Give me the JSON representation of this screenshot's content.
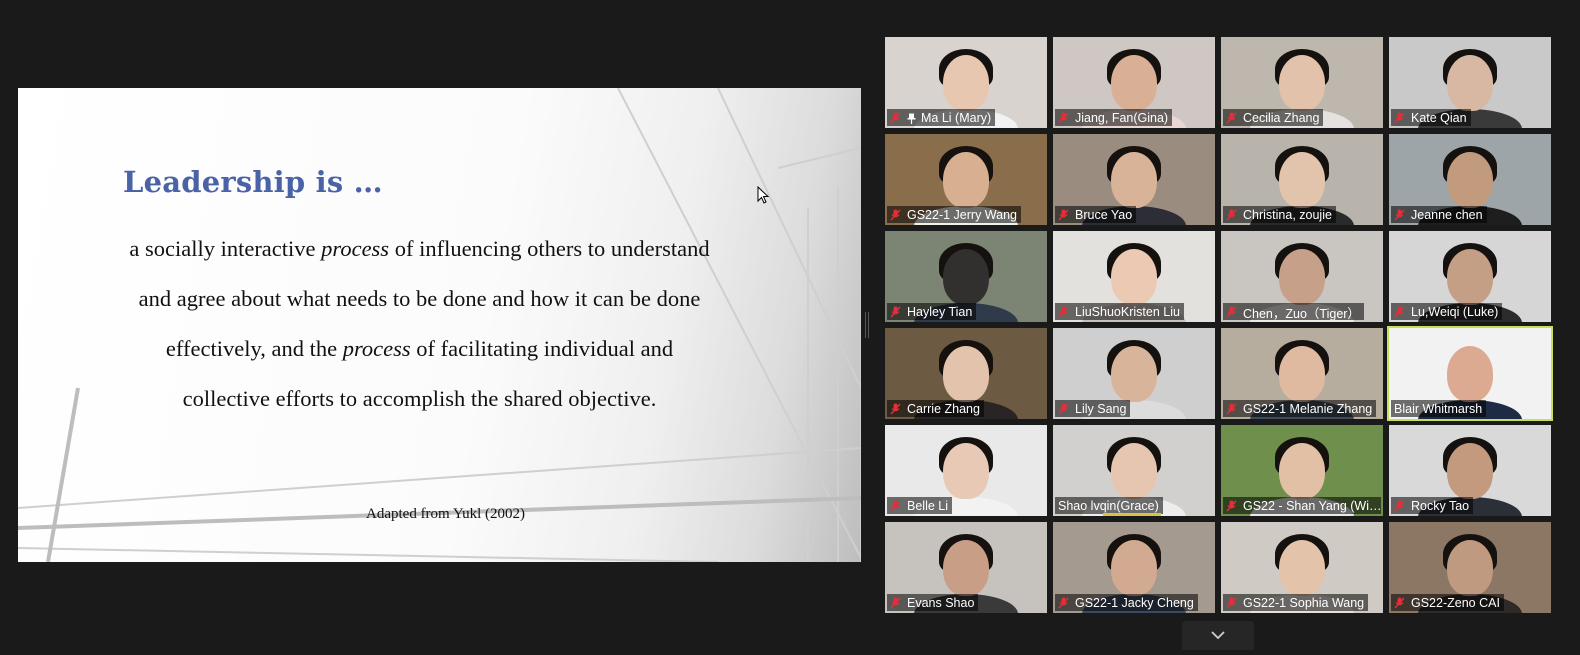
{
  "slide": {
    "title": "Leadership is …",
    "body_lines": [
      {
        "pre": "a socially interactive ",
        "em": "process",
        "post": " of influencing others to understand"
      },
      {
        "pre": "and agree about what needs to be done and how it can be done",
        "em": "",
        "post": ""
      },
      {
        "pre": "effectively, and the ",
        "em": "process",
        "post": " of facilitating individual and"
      },
      {
        "pre": "collective efforts to accomplish the shared objective.",
        "em": "",
        "post": ""
      }
    ],
    "source": "Adapted from Yukl (2002)"
  },
  "participants": [
    {
      "name": "Ma Li (Mary)",
      "muted": true,
      "pinned": true,
      "bg": "#d8d3cf",
      "skin": "#e7c7b0",
      "hair": true,
      "shirt": "#f2f2f2"
    },
    {
      "name": "Jiang, Fan(Gina)",
      "muted": true,
      "bg": "#cfc7c4",
      "skin": "#d9b095",
      "hair": true,
      "shirt": "#e8d7d2"
    },
    {
      "name": "Cecilia Zhang",
      "muted": true,
      "bg": "#bdb7ae",
      "skin": "#e2c2aa",
      "hair": true,
      "shirt": "#e4e1de"
    },
    {
      "name": "Kate Qian",
      "muted": true,
      "bg": "#c9c9c9",
      "skin": "#d9b8a3",
      "hair": true,
      "shirt": "#3a3a3a"
    },
    {
      "name": "GS22-1 Jerry Wang",
      "muted": true,
      "bg": "#8a6e4c",
      "skin": "#d8b091",
      "hair": true,
      "shirt": "#f0efea"
    },
    {
      "name": "Bruce Yao",
      "muted": true,
      "bg": "#9a8c7f",
      "skin": "#d9b398",
      "hair": true,
      "shirt": "#2c2d35"
    },
    {
      "name": "Christina, zoujie",
      "muted": true,
      "bg": "#b8b4ab",
      "skin": "#e2c4ad",
      "hair": true,
      "shirt": "#2a2a2a"
    },
    {
      "name": "Jeanne chen",
      "muted": true,
      "bg": "#9ea5a8",
      "skin": "#c29a7e",
      "hair": true,
      "shirt": "#1e1e1e"
    },
    {
      "name": "Hayley Tian",
      "muted": true,
      "bg": "#7c8473",
      "skin": "#31302e",
      "hair": true,
      "shirt": "#2f3a4a"
    },
    {
      "name": "LiuShuoKristen Liu",
      "muted": true,
      "bg": "#e3e1de",
      "skin": "#ecc9b3",
      "hair": true,
      "shirt": "#c9c2bc"
    },
    {
      "name": "Chen，Zuo（Tiger）",
      "muted": true,
      "bg": "#c9c6c2",
      "skin": "#c7a089",
      "hair": true,
      "shirt": "#ece9e6"
    },
    {
      "name": "Lu,Weiqi (Luke)",
      "muted": true,
      "bg": "#d6d6d6",
      "skin": "#c59e86",
      "hair": true,
      "shirt": "#2e2b2b"
    },
    {
      "name": "Carrie Zhang",
      "muted": true,
      "bg": "#6d5a43",
      "skin": "#e3c3ab",
      "hair": true,
      "shirt": "#2a2525"
    },
    {
      "name": "Lily  Sang",
      "muted": true,
      "bg": "#cfcfcf",
      "skin": "#d8b49b",
      "hair": true,
      "shirt": "#dcdcdc"
    },
    {
      "name": "GS22-1 Melanie Zhang",
      "muted": true,
      "bg": "#b6ad9e",
      "skin": "#dfbaa0",
      "hair": true,
      "shirt": "#3f4c5a"
    },
    {
      "name": "Blair Whitmarsh",
      "muted": false,
      "active": true,
      "bg": "#f2f2f2",
      "skin": "#dcaa90",
      "hair": false,
      "shirt": "#1f2a44"
    },
    {
      "name": "Belle Li",
      "muted": true,
      "bg": "#e9e9e9",
      "skin": "#e8c9b6",
      "hair": true,
      "shirt": "#f2f2f2"
    },
    {
      "name": "Shao lvqin(Grace)",
      "muted": false,
      "speaking": true,
      "bg": "#d2d0ce",
      "skin": "#e6c6b0",
      "hair": true,
      "shirt": "#ededed"
    },
    {
      "name": "GS22 - Shan Yang (Wi…",
      "muted": true,
      "bg": "#6f8f4d",
      "skin": "#e1c0a6",
      "hair": true,
      "shirt": "#e9e9e9"
    },
    {
      "name": "Rocky Tao",
      "muted": true,
      "bg": "#d9d9d9",
      "skin": "#c39a7e",
      "hair": true,
      "shirt": "#2b2f38"
    },
    {
      "name": "Evans Shao",
      "muted": true,
      "bg": "#c6c3bf",
      "skin": "#c89e86",
      "hair": true,
      "shirt": "#3a3a3a"
    },
    {
      "name": "GS22-1 Jacky Cheng",
      "muted": true,
      "bg": "#a59a90",
      "skin": "#d2aa92",
      "hair": true,
      "shirt": "#3d4a5d"
    },
    {
      "name": "GS22-1 Sophia Wang",
      "muted": true,
      "bg": "#cfcac4",
      "skin": "#e4c3ab",
      "hair": true,
      "shirt": "#e6e0da"
    },
    {
      "name": "GS22-Zeno CAI",
      "muted": true,
      "bg": "#8c7764",
      "skin": "#c09a80",
      "hair": true,
      "shirt": "#2d2a27"
    }
  ],
  "colors": {
    "active_speaker_border": "#c4e05c",
    "mute_icon": "#e0303a",
    "title_blue": "#4a63a7"
  },
  "icons": {
    "mute": "microphone-muted-icon",
    "pin": "pin-icon",
    "scroll": "chevron-down-icon",
    "cursor": "mouse-cursor-icon"
  }
}
